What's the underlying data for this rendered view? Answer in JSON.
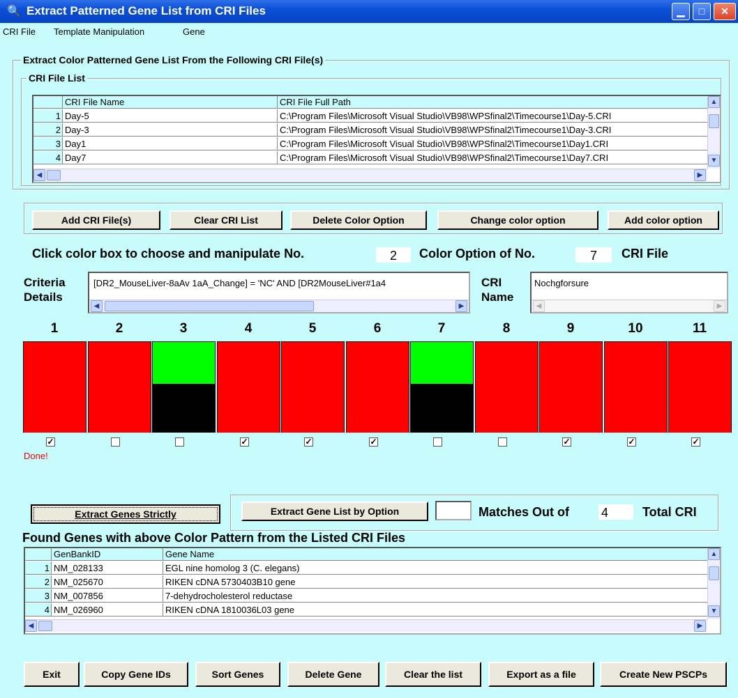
{
  "window": {
    "title": "Extract Patterned Gene List from CRI Files",
    "app_icon": "binoculars-icon"
  },
  "menu": [
    "CRI File",
    "Template Manipulation",
    "Gene"
  ],
  "main_group": {
    "label": "Extract Color Patterned Gene List  From the Following CRI File(s)"
  },
  "cri_list": {
    "label": "CRI File List",
    "columns": [
      "CRI File Name",
      "CRI File Full Path"
    ],
    "rows": [
      {
        "n": "1",
        "name": "Day-5",
        "path": "C:\\Program Files\\Microsoft Visual Studio\\VB98\\WPSfinal2\\Timecourse1\\Day-5.CRI"
      },
      {
        "n": "2",
        "name": "Day-3",
        "path": "C:\\Program Files\\Microsoft Visual Studio\\VB98\\WPSfinal2\\Timecourse1\\Day-3.CRI"
      },
      {
        "n": "3",
        "name": "Day1",
        "path": "C:\\Program Files\\Microsoft Visual Studio\\VB98\\WPSfinal2\\Timecourse1\\Day1.CRI"
      },
      {
        "n": "4",
        "name": "Day7",
        "path": "C:\\Program Files\\Microsoft Visual Studio\\VB98\\WPSfinal2\\Timecourse1\\Day7.CRI"
      }
    ]
  },
  "cri_buttons": [
    "Add CRI File(s)",
    "Clear CRI List",
    "Delete Color Option",
    "Change color option",
    "Add color option"
  ],
  "instruction": {
    "prefix": "Click color box to choose and manipulate No.",
    "option_no": "2",
    "middle": "Color Option  of No.",
    "file_no": "7",
    "suffix": "CRI File"
  },
  "criteria": {
    "label_line1": "Criteria",
    "label_line2": "Details",
    "value": "[DR2_MouseLiver-8aAv 1aA_Change] = 'NC' AND  [DR2MouseLiver#1a4"
  },
  "cri_name": {
    "label_line1": "CRI",
    "label_line2": "Name",
    "value": "Nochgforsure"
  },
  "columns": [
    {
      "num": "1",
      "top": "#ff0000",
      "bottom": "#ff0000",
      "checked": true
    },
    {
      "num": "2",
      "top": "#ff0000",
      "bottom": "#ff0000",
      "checked": false
    },
    {
      "num": "3",
      "top": "#00ff00",
      "bottom": "#000000",
      "checked": false
    },
    {
      "num": "4",
      "top": "#ff0000",
      "bottom": "#ff0000",
      "checked": true
    },
    {
      "num": "5",
      "top": "#ff0000",
      "bottom": "#ff0000",
      "checked": true
    },
    {
      "num": "6",
      "top": "#ff0000",
      "bottom": "#ff0000",
      "checked": true
    },
    {
      "num": "7",
      "top": "#00ff00",
      "bottom": "#000000",
      "checked": false
    },
    {
      "num": "8",
      "top": "#ff0000",
      "bottom": "#ff0000",
      "checked": false
    },
    {
      "num": "9",
      "top": "#ff0000",
      "bottom": "#ff0000",
      "checked": true
    },
    {
      "num": "10",
      "top": "#ff0000",
      "bottom": "#ff0000",
      "checked": true
    },
    {
      "num": "11",
      "top": "#ff0000",
      "bottom": "#ff0000",
      "checked": true
    }
  ],
  "status": {
    "text": "Done!",
    "color": "#e00000"
  },
  "extract": {
    "strict_button": "Extract Genes Strictly",
    "option_button": "Extract Gene List by Option",
    "matches_value": "",
    "matches_label": "Matches Out of",
    "total_value": "4",
    "total_label": "Total CRI"
  },
  "found": {
    "label": "Found Genes with above Color Pattern  from the Listed CRI Files",
    "columns": [
      "GenBankID",
      "Gene Name"
    ],
    "rows": [
      {
        "n": "1",
        "id": "NM_028133",
        "name": "EGL nine homolog 3 (C. elegans)"
      },
      {
        "n": "2",
        "id": "NM_025670",
        "name": "RIKEN cDNA 5730403B10 gene"
      },
      {
        "n": "3",
        "id": "NM_007856",
        "name": "7-dehydrocholesterol reductase"
      },
      {
        "n": "4",
        "id": "NM_026960",
        "name": "RIKEN cDNA 1810036L03 gene"
      }
    ]
  },
  "bottom_buttons": [
    "Exit",
    "Copy Gene IDs",
    "Sort Genes",
    "Delete Gene",
    "Clear the list",
    "Export as a file",
    "Create New PSCPs"
  ]
}
